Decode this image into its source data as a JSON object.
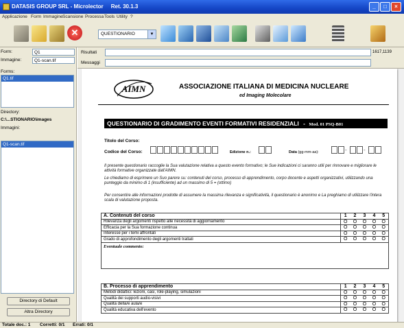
{
  "window": {
    "title": "DATASIS GROUP SRL - Microlector     Ret. 30.1.3",
    "colors": {
      "titlebar": "#1546c6",
      "close": "#e0482c",
      "panel": "#ece9d8",
      "selection": "#316ac5"
    }
  },
  "menu": [
    "Applicazione",
    "Form",
    "Immagine",
    "Scansione",
    "Processa",
    "Tools",
    "Utility",
    "?"
  ],
  "toolbar": {
    "select_value": "QUESTIONARIO",
    "icons": [
      "scanner-icon",
      "folder-open-icon",
      "download-icon",
      "stop-icon",
      "page-icon",
      "monitor-icon",
      "computer-icon",
      "book-icon",
      "printer-icon",
      "checklist-icon",
      "export-icon",
      "grid-icon",
      "exit-icon"
    ]
  },
  "left": {
    "form_label": "Form:",
    "form_value": "Q1",
    "image_label": "Immagine:",
    "image_value": "Q1-scan.tif",
    "forms_label": "Forms:",
    "forms": [
      "Q1.tif"
    ],
    "directory_label": "Directory:",
    "directory_value": "C:\\...STIONARIO\\images",
    "images_label": "Immagini:",
    "images": [
      "Q1-scan.tif"
    ],
    "default_dir_button": "Directory di Default",
    "other_dir_button": "Altra Directory"
  },
  "info": {
    "results_label": "Risultati",
    "messages_label": "Messaggi",
    "coords": "1617,1139"
  },
  "document": {
    "org_name": "ASSOCIAZIONE ITALIANA DI MEDICINA NUCLEARE",
    "org_sub": "ed Imaging Molecolare",
    "logo": "AIMN",
    "header": "QUESTIONARIO DI GRADIMENTO EVENTI FORMATIVI RESIDENZIALI",
    "header_dash": "-",
    "header_mod": "Mod. 01 PSQ-B01",
    "titolo_label": "Titolo del Corso:",
    "codice_label": "Codice del Corso:",
    "edizione_label": "Edizione n.:",
    "data_label": "Data",
    "data_fmt": "(gg-mm-aa):",
    "para1": "Il presente questionario raccoglie la Sua valutazione relativa a questo evento formativo; le Sue indicazioni ci saranno utili per rinnovare e migliorare le attività formative organizzate dall'AIMN.",
    "para2": "Le chiediamo di esprimere un Suo parere su: contenuti del corso, processo di apprendimento, corpo docente e aspetti organizzativi, utilizzando una punteggio da minimo di 1 (insufficiente) ad un massimo di 5 = (ottimo)",
    "para3": "Per consentire alle informazioni prodotte di assumere la massima rilevanza e significatività, il questionario è anonimo e La preghiamo di utilizzare l'intera scala di valutazione proposta.",
    "scale": [
      "1",
      "2",
      "3",
      "4",
      "5"
    ],
    "radio": "O",
    "sectionA": {
      "title": "A.  Contenuti del corso",
      "rows": [
        "Rilevanza degli argomenti rispetto alle necessità di aggiornamento",
        "Efficacia per la Sua formazione continua",
        "Interesse per i temi affrontati",
        "Grado di approfondimento degli argomenti trattati"
      ],
      "comments": "Eventuale commento:"
    },
    "sectionB": {
      "title": "B.  Processo di apprendimento",
      "rows": [
        "Metodi didattici: lezioni, casi, role-playing, simulazioni",
        "Qualità dei supporti audio-visivi",
        "Qualità della/e aula/e",
        "Qualità educativa dell'evento"
      ]
    }
  },
  "status": {
    "total": "Totale doc.: 1",
    "correct": "Corretti: 0/1",
    "errors": "Errati: 0/1"
  }
}
